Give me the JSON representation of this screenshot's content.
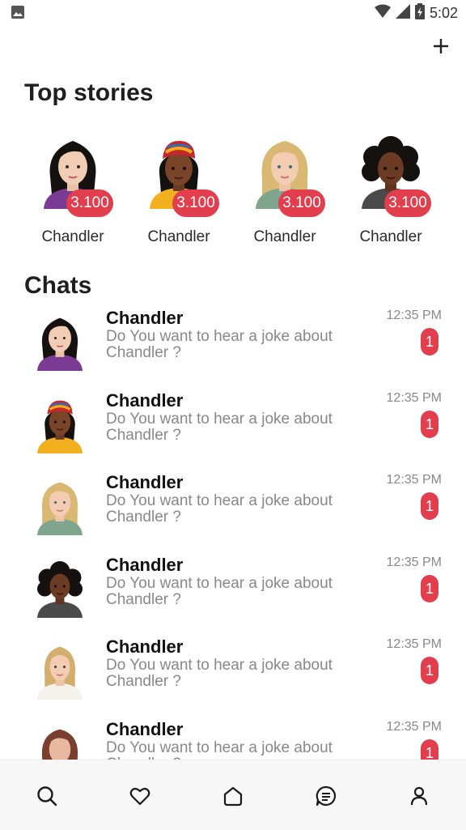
{
  "status_bar": {
    "time": "5:02",
    "icons": [
      "image-notification-icon",
      "wifi-icon",
      "signal-icon",
      "battery-charging-icon"
    ]
  },
  "header": {
    "add_icon": "plus-icon"
  },
  "top_stories": {
    "title": "Top stories",
    "items": [
      {
        "name": "Chandler",
        "count": "3.100",
        "avatar": "avatar-dark-hair-purple-top"
      },
      {
        "name": "Chandler",
        "count": "3.100",
        "avatar": "avatar-headwrap-yellow-top"
      },
      {
        "name": "Chandler",
        "count": "3.100",
        "avatar": "avatar-blonde-green-top"
      },
      {
        "name": "Chandler",
        "count": "3.100",
        "avatar": "avatar-curly-hair-grey-top"
      }
    ]
  },
  "chats": {
    "title": "Chats",
    "items": [
      {
        "name": "Chandler",
        "message": "Do You want to hear a joke about Chandler ?",
        "time": "12:35 PM",
        "unread": "1",
        "avatar": "avatar-dark-hair-purple-top"
      },
      {
        "name": "Chandler",
        "message": "Do You want to hear a joke about Chandler ?",
        "time": "12:35 PM",
        "unread": "1",
        "avatar": "avatar-headwrap-yellow-top"
      },
      {
        "name": "Chandler",
        "message": "Do You want to hear a joke about Chandler ?",
        "time": "12:35 PM",
        "unread": "1",
        "avatar": "avatar-blonde-green-top"
      },
      {
        "name": "Chandler",
        "message": "Do You want to hear a joke about Chandler ?",
        "time": "12:35 PM",
        "unread": "1",
        "avatar": "avatar-curly-hair-grey-top"
      },
      {
        "name": "Chandler",
        "message": "Do You want to hear a joke about Chandler ?",
        "time": "12:35 PM",
        "unread": "1",
        "avatar": "avatar-blonde-white-top"
      },
      {
        "name": "Chandler",
        "message": "Do You want to hear a joke about Chandler ?",
        "time": "12:35 PM",
        "unread": "1",
        "avatar": "avatar-auburn-hair"
      }
    ]
  },
  "bottom_nav": {
    "items": [
      {
        "icon": "search-icon"
      },
      {
        "icon": "heart-icon"
      },
      {
        "icon": "home-icon"
      },
      {
        "icon": "chat-icon"
      },
      {
        "icon": "profile-icon"
      }
    ]
  },
  "colors": {
    "badge": "#e23e4e",
    "nav_bg": "#f7f7f7",
    "text_secondary": "#888888"
  }
}
